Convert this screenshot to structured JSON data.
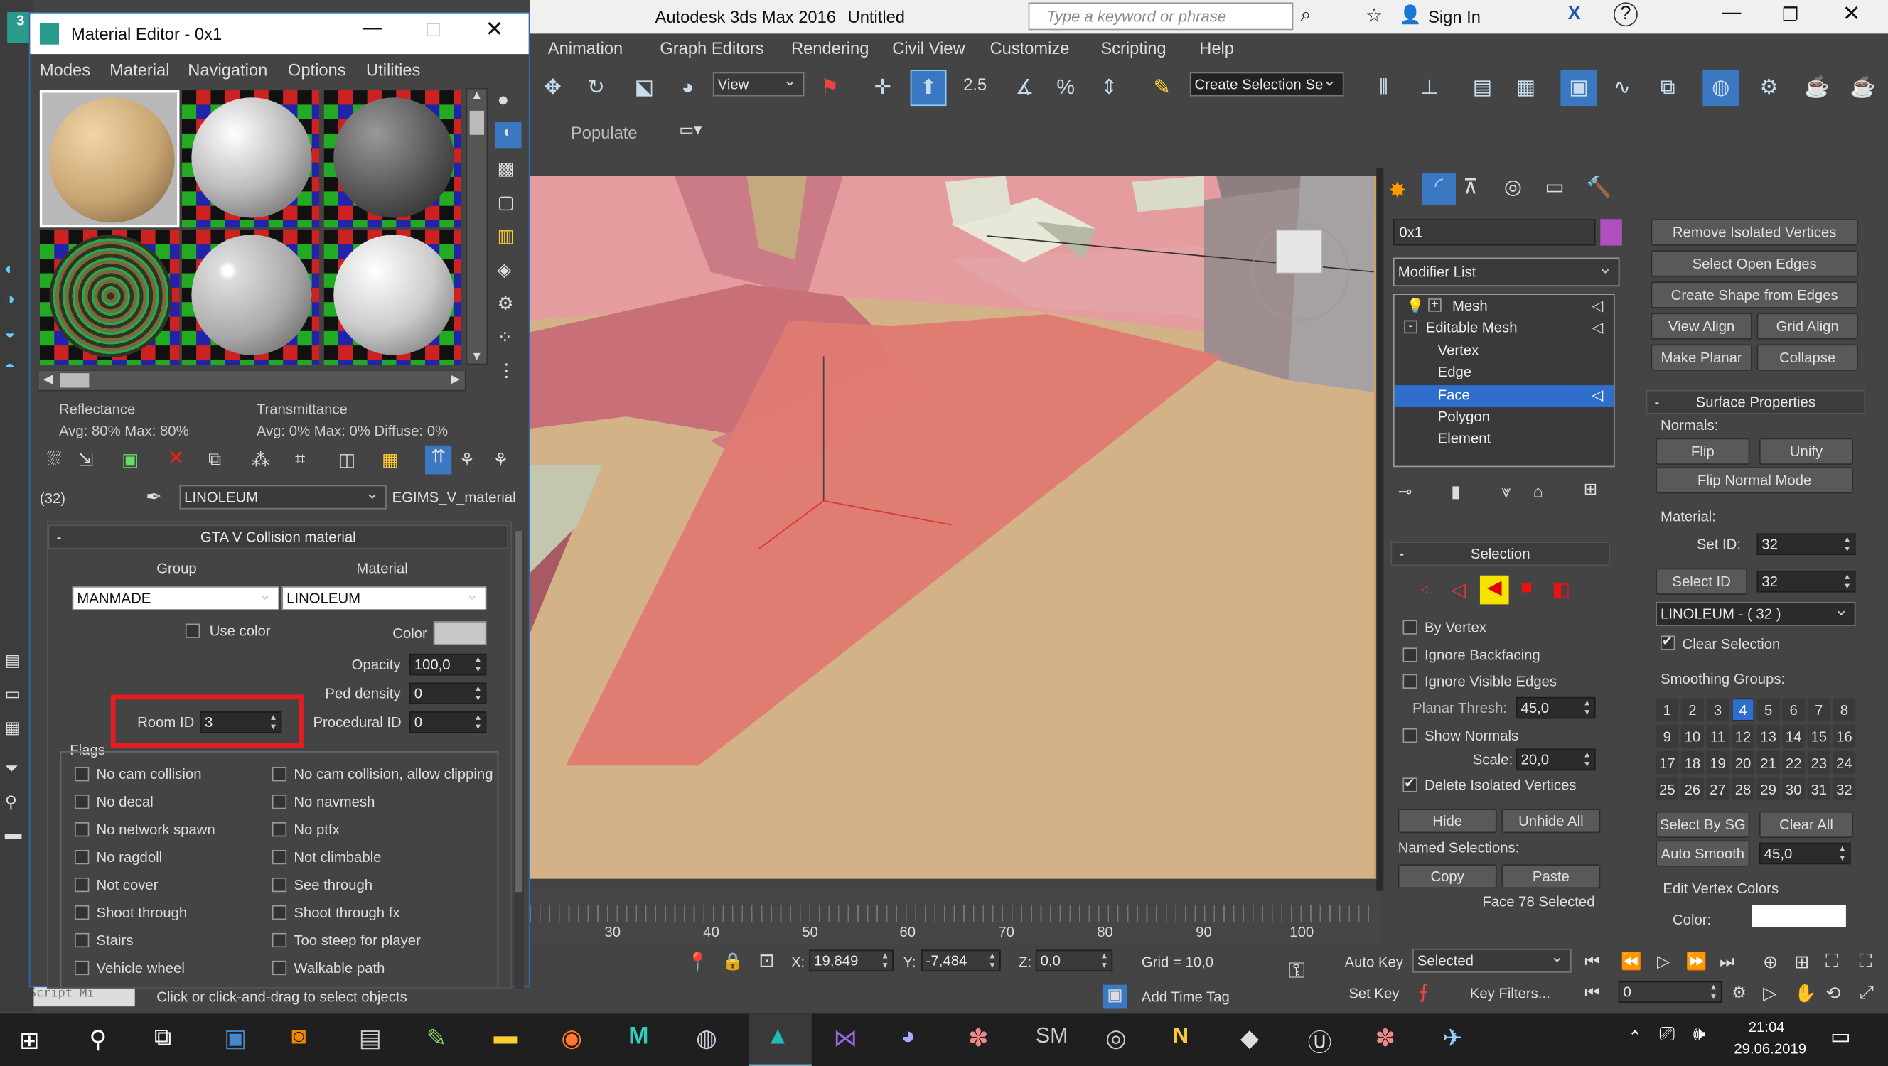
{
  "main_window": {
    "title": "Autodesk 3ds Max 2016",
    "doc": "Untitled",
    "search_placeholder": "Type a keyword or phrase",
    "sign_in": "Sign In"
  },
  "menubar": [
    "Animation",
    "Graph Editors",
    "Rendering",
    "Civil View",
    "Customize",
    "Scripting",
    "Help"
  ],
  "toolbar": {
    "view_dropdown": "View",
    "selection_set": "Create Selection Se",
    "snap_25": "2.5",
    "populate": "Populate"
  },
  "mat_editor": {
    "title": "Material Editor - 0x1",
    "menu": [
      "Modes",
      "Material",
      "Navigation",
      "Options",
      "Utilities"
    ],
    "reflectance": "Reflectance",
    "refl_vals": "Avg:  80% Max:  80%",
    "transmittance": "Transmittance",
    "trans_vals": "Avg:   0% Max:   0%  Diffuse:   0%",
    "mat_count": "(32)",
    "mat_name": "LINOLEUM",
    "mat_type": "EGIMS_V_material",
    "rollout": "GTA V Collision material",
    "group_label": "Group",
    "material_label": "Material",
    "group_value": "MANMADE",
    "material_value": "LINOLEUM",
    "use_color": "Use color",
    "color": "Color",
    "opacity_label": "Opacity",
    "opacity": "100,0",
    "ped_label": "Ped density",
    "ped": "0",
    "room_label": "Room ID",
    "room": "3",
    "proc_label": "Procedural ID",
    "proc": "0",
    "flags_label": "Flags",
    "flags_left": [
      "No cam collision",
      "No decal",
      "No network spawn",
      "No ragdoll",
      "Not cover",
      "Shoot through",
      "Stairs",
      "Vehicle wheel"
    ],
    "flags_right": [
      "No cam collision, allow clipping",
      "No navmesh",
      "No ptfx",
      "Not climbable",
      "See through",
      "Shoot through fx",
      "Too steep for player",
      "Walkable path"
    ]
  },
  "cmd_panel": {
    "object_name": "0x1",
    "modifier_list": "Modifier List",
    "stack": [
      "Mesh",
      "Editable Mesh",
      "Vertex",
      "Edge",
      "Face",
      "Polygon",
      "Element"
    ],
    "selection_hdr": "Selection",
    "by_vertex": "By Vertex",
    "ignore_backfacing": "Ignore Backfacing",
    "ignore_visible": "Ignore Visible Edges",
    "planar_label": "Planar Thresh:",
    "planar": "45,0",
    "show_normals": "Show Normals",
    "scale_label": "Scale:",
    "scale": "20,0",
    "delete_isolated": "Delete Isolated Vertices",
    "hide": "Hide",
    "unhide_all": "Unhide All",
    "named_sel": "Named Selections:",
    "copy": "Copy",
    "paste": "Paste",
    "status": "Face 78 Selected",
    "ops": {
      "remove_isolated": "Remove Isolated Vertices",
      "select_open": "Select Open Edges",
      "create_shape": "Create Shape from Edges",
      "view_align": "View Align",
      "grid_align": "Grid Align",
      "make_planar": "Make Planar",
      "collapse": "Collapse"
    },
    "surface_hdr": "Surface Properties",
    "normals": "Normals:",
    "flip": "Flip",
    "unify": "Unify",
    "flip_normal_mode": "Flip Normal Mode",
    "material": "Material:",
    "set_id_label": "Set ID:",
    "set_id": "32",
    "select_id": "Select ID",
    "select_id_val": "32",
    "mat_dd": "LINOLEUM - ( 32 )",
    "clear_selection": "Clear Selection",
    "smoothing": "Smoothing Groups:",
    "sg": [
      "1",
      "2",
      "3",
      "4",
      "5",
      "6",
      "7",
      "8",
      "9",
      "10",
      "11",
      "12",
      "13",
      "14",
      "15",
      "16",
      "17",
      "18",
      "19",
      "20",
      "21",
      "22",
      "23",
      "24",
      "25",
      "26",
      "27",
      "28",
      "29",
      "30",
      "31",
      "32"
    ],
    "select_by_sg": "Select By SG",
    "clear_all": "Clear All",
    "auto_smooth": "Auto Smooth",
    "auto_smooth_val": "45,0",
    "edit_vertex_colors": "Edit Vertex Colors",
    "color_label": "Color:"
  },
  "timeline": {
    "ticks": [
      "30",
      "40",
      "50",
      "60",
      "70",
      "80",
      "90",
      "100"
    ]
  },
  "statusbar": {
    "x_label": "X:",
    "x": "19,849",
    "y_label": "Y:",
    "y": "-7,484",
    "z_label": "Z:",
    "z": "0,0",
    "grid": "Grid = 10,0",
    "auto_key": "Auto Key",
    "selected": "Selected",
    "set_key": "Set Key",
    "key_filters": "Key Filters...",
    "frame": "0",
    "add_time_tag": "Add Time Tag",
    "prompt": "Click or click-and-drag to select objects",
    "maxscript": "MAXScript Mi"
  },
  "taskbar": {
    "time": "21:04",
    "date": "29.06.2019"
  },
  "colors": {
    "viewport": "#d4b287",
    "pink": "#d67d7d",
    "accent": "#2f6ecc",
    "red_highlight": "#e51c23"
  }
}
